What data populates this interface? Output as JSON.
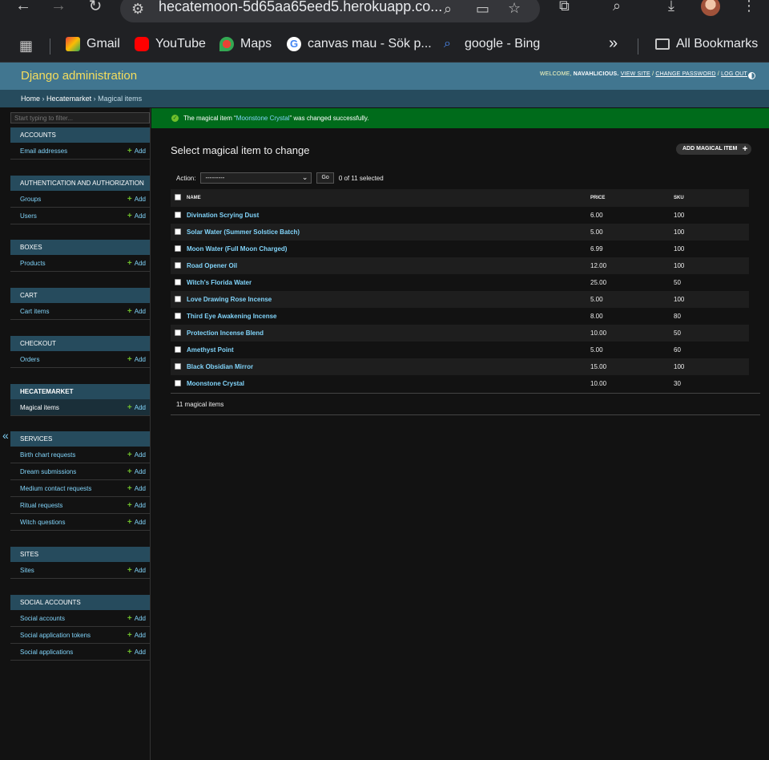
{
  "browser": {
    "url": "hecatemoon-5d65aa65eed5.herokuapp.co...",
    "bookmarks": [
      {
        "label": "Gmail"
      },
      {
        "label": "YouTube"
      },
      {
        "label": "Maps"
      },
      {
        "label": "canvas mau - Sök p..."
      },
      {
        "label": "google - Bing"
      }
    ],
    "more": "»",
    "all_bookmarks": "All Bookmarks"
  },
  "header": {
    "site_name": "Django administration",
    "welcome": "WELCOME,",
    "username": "NAVAHLICIOUS.",
    "view_site": "VIEW SITE",
    "change_password": "CHANGE PASSWORD",
    "log_out": "LOG OUT",
    "slash": "/"
  },
  "breadcrumbs": {
    "home": "Home",
    "sep": "›",
    "app": "Hecatemarket",
    "model": "Magical items"
  },
  "sidebar": {
    "filter_placeholder": "Start typing to filter...",
    "add_label": "Add",
    "collapse_label": "«",
    "modules": [
      {
        "caption": "ACCOUNTS",
        "models": [
          "Email addresses"
        ]
      },
      {
        "caption": "AUTHENTICATION AND AUTHORIZATION",
        "models": [
          "Groups",
          "Users"
        ]
      },
      {
        "caption": "BOXES",
        "models": [
          "Products"
        ]
      },
      {
        "caption": "CART",
        "models": [
          "Cart items"
        ]
      },
      {
        "caption": "CHECKOUT",
        "models": [
          "Orders"
        ]
      },
      {
        "caption": "HECATEMARKET",
        "models": [
          "Magical items"
        ]
      },
      {
        "caption": "SERVICES",
        "models": [
          "Birth chart requests",
          "Dream submissions",
          "Medium contact requests",
          "Ritual requests",
          "Witch questions"
        ]
      },
      {
        "caption": "SITES",
        "models": [
          "Sites"
        ]
      },
      {
        "caption": "SOCIAL ACCOUNTS",
        "models": [
          "Social accounts",
          "Social application tokens",
          "Social applications"
        ]
      }
    ]
  },
  "message": {
    "prefix": "The magical item “",
    "link": "Moonstone Crystal",
    "suffix": "” was changed successfully."
  },
  "content": {
    "title": "Select magical item to change",
    "add_button": "ADD MAGICAL ITEM",
    "action_label": "Action:",
    "action_value": "---------",
    "go": "Go",
    "selected": "0 of 11 selected",
    "columns": {
      "name": "NAME",
      "price": "PRICE",
      "sku": "SKU"
    },
    "rows": [
      {
        "name": "Divination Scrying Dust",
        "price": "6.00",
        "sku": "100"
      },
      {
        "name": "Solar Water (Summer Solstice Batch)",
        "price": "5.00",
        "sku": "100"
      },
      {
        "name": "Moon Water (Full Moon Charged)",
        "price": "6.99",
        "sku": "100"
      },
      {
        "name": "Road Opener Oil",
        "price": "12.00",
        "sku": "100"
      },
      {
        "name": "Witch's Florida Water",
        "price": "25.00",
        "sku": "50"
      },
      {
        "name": "Love Drawing Rose Incense",
        "price": "5.00",
        "sku": "100"
      },
      {
        "name": "Third Eye Awakening Incense",
        "price": "8.00",
        "sku": "80"
      },
      {
        "name": "Protection Incense Blend",
        "price": "10.00",
        "sku": "50"
      },
      {
        "name": "Amethyst Point",
        "price": "5.00",
        "sku": "60"
      },
      {
        "name": "Black Obsidian Mirror",
        "price": "15.00",
        "sku": "100"
      },
      {
        "name": "Moonstone Crystal",
        "price": "10.00",
        "sku": "30"
      }
    ],
    "paginator": "11 magical items"
  }
}
